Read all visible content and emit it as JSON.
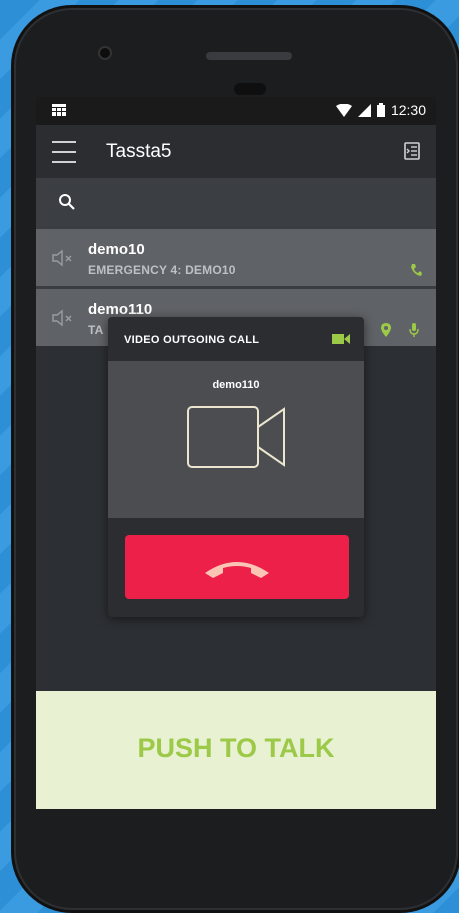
{
  "status_bar": {
    "time": "12:30"
  },
  "app_bar": {
    "title": "Tassta5"
  },
  "contacts": [
    {
      "name": "demo10",
      "subtitle": "EMERGENCY 4: DEMO10"
    },
    {
      "name": "demo110",
      "subtitle": "TA"
    }
  ],
  "dialog": {
    "title": "VIDEO OUTGOING CALL",
    "callee": "demo110"
  },
  "ptt": {
    "label": "PUSH TO TALK"
  },
  "colors": {
    "accent_green": "#9cc948",
    "hangup_red": "#ec2049",
    "ptt_background": "#e8f1d2"
  },
  "icons": [
    "grid-icon",
    "wifi-icon",
    "signal-icon",
    "battery-icon",
    "menu-icon",
    "call-log-icon",
    "search-icon",
    "speaker-muted-icon",
    "phone-icon",
    "location-pin-icon",
    "microphone-icon",
    "video-icon",
    "video-camera-icon",
    "hangup-icon"
  ]
}
